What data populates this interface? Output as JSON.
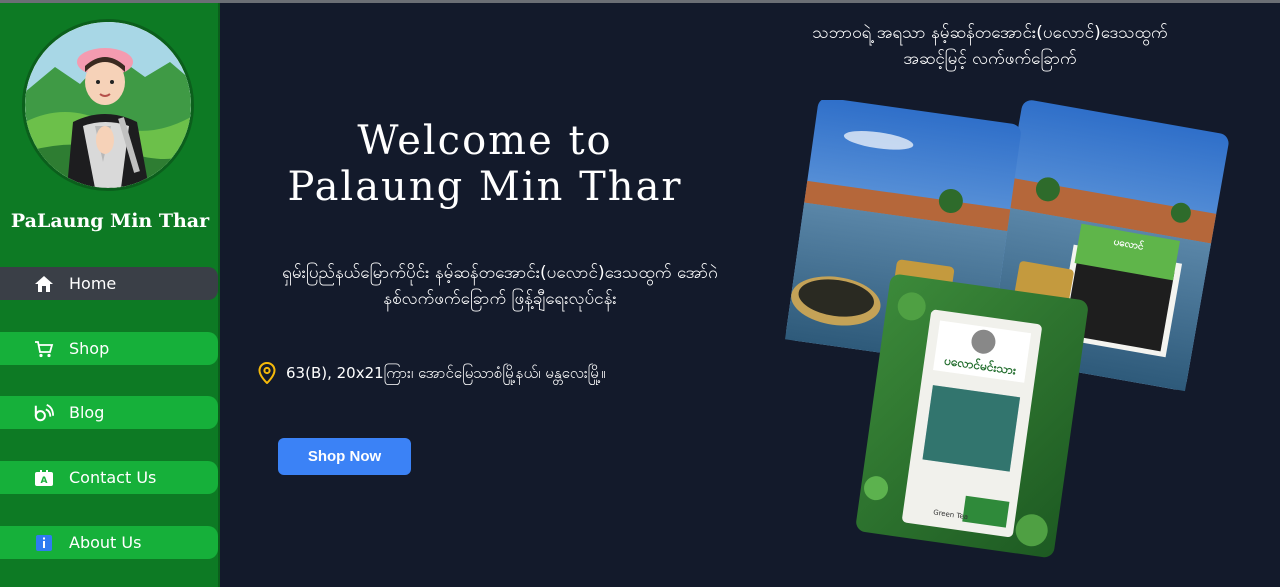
{
  "brand": {
    "name": "PaLaung Min Thar"
  },
  "nav": {
    "items": [
      {
        "label": "Home",
        "icon": "home-icon"
      },
      {
        "label": "Shop",
        "icon": "cart-icon"
      },
      {
        "label": "Blog",
        "icon": "blog-icon"
      },
      {
        "label": "Contact Us",
        "icon": "contact-card-icon"
      },
      {
        "label": "About Us",
        "icon": "info-icon"
      }
    ]
  },
  "hero": {
    "welcome_line1": "Welcome to",
    "welcome_line2": "Palaung Min Thar",
    "subtitle_line1": "ရှမ်းပြည်နယ်မြောက်ပိုင်း နမ့်ဆန်တအောင်း(ပလောင်)ဒေသထွက် အော်ဂဲ",
    "subtitle_line2": "နစ်လက်ဖက်ခြောက် ဖြန့်ချီရေးလုပ်ငန်း",
    "address": "63(B), 20x21ကြား၊ အောင်မြေသာစံမြို့နယ်၊ မန္တလေးမြို့။",
    "cta_label": "Shop Now"
  },
  "tagline": {
    "line1": "သဘာဝရဲ့ အရသာ နမ့်ဆန်တအောင်း(ပလောင်)ဒေသထွက်",
    "line2": "အဆင့်မြင့် လက်ဖက်ခြောက်"
  },
  "product": {
    "pack_brand": "ပလောင်မင်းသား",
    "pack_tag": "Green Tea"
  },
  "colors": {
    "sidebar": "#0d7a24",
    "nav_button": "#16b03a",
    "nav_active": "#3a3f47",
    "background": "#131a2b",
    "cta": "#3b82f6",
    "pin": "#f5b90a"
  }
}
